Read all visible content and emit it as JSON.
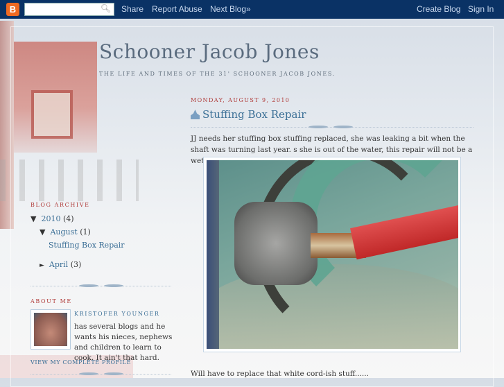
{
  "navbar": {
    "logo": "B",
    "search_placeholder": "",
    "links": {
      "share": "Share",
      "report": "Report Abuse",
      "next": "Next Blog»",
      "create": "Create Blog",
      "signin": "Sign In"
    }
  },
  "blog": {
    "title": "Schooner Jacob Jones",
    "description": "THE LIFE AND TIMES OF THE 31' SCHOONER JACOB JONES."
  },
  "post": {
    "date": "MONDAY, AUGUST 9, 2010",
    "title": "Stuffing Box Repair",
    "para1": "JJ needs her stuffing box stuffing replaced, she was leaking a bit when the shaft was turning last year. s she is out of the water, this repair will not be a wet as it might be...",
    "para2": "Will have to replace that white cord-ish stuff......"
  },
  "archive": {
    "heading": "BLOG ARCHIVE",
    "year": "2010",
    "year_count": "(4)",
    "month1": "August",
    "month1_count": "(1)",
    "post1": "Stuffing Box Repair",
    "month2": "April",
    "month2_count": "(3)"
  },
  "about": {
    "heading": "ABOUT ME",
    "name": "KRISTOFER YOUNGER",
    "bio": "has several blogs and he wants his nieces, nephews and children to learn to cook. It ain't that hard.",
    "profile_link": "VIEW MY COMPLETE PROFILE"
  }
}
